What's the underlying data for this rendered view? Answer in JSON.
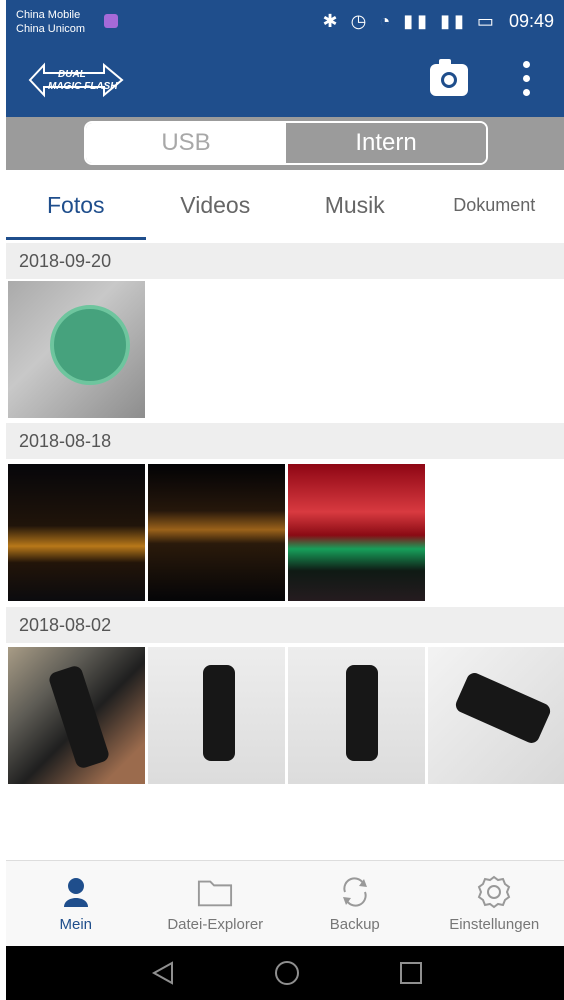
{
  "status_bar": {
    "carrier_1": "China Mobile",
    "carrier_2": "China Unicom",
    "time": "09:49",
    "icons": [
      "bluetooth-icon",
      "alarm-icon",
      "wifi-icon",
      "signal-2g-icon",
      "signal-4g-icon",
      "battery-icon"
    ]
  },
  "app_bar": {
    "logo_text": {
      "line1": "DUAL",
      "line2": "MAGIC FLASH"
    },
    "camera_icon": "camera-icon",
    "more_icon": "more-vertical-icon"
  },
  "storage_toggle": {
    "usb_label": "USB",
    "intern_label": "Intern",
    "selected": "Intern"
  },
  "tabs": [
    {
      "label": "Fotos",
      "selected": true
    },
    {
      "label": "Videos",
      "selected": false
    },
    {
      "label": "Musik",
      "selected": false
    },
    {
      "label": "Dokument",
      "selected": false
    }
  ],
  "gallery": {
    "sections": [
      {
        "date": "2018-09-20",
        "photos": 1
      },
      {
        "date": "2018-08-18",
        "photos": 3
      },
      {
        "date": "2018-08-02",
        "photos": 4
      }
    ]
  },
  "bottom_nav": [
    {
      "label": "Mein",
      "icon": "user-icon",
      "selected": true
    },
    {
      "label": "Datei-Explorer",
      "icon": "folder-icon",
      "selected": false
    },
    {
      "label": "Backup",
      "icon": "sync-icon",
      "selected": false
    },
    {
      "label": "Einstellungen",
      "icon": "gear-icon",
      "selected": false
    }
  ],
  "colors": {
    "primary": "#1f4e8c",
    "toggle_gray": "#9b9b9b",
    "section_bg": "#eeeeee"
  }
}
